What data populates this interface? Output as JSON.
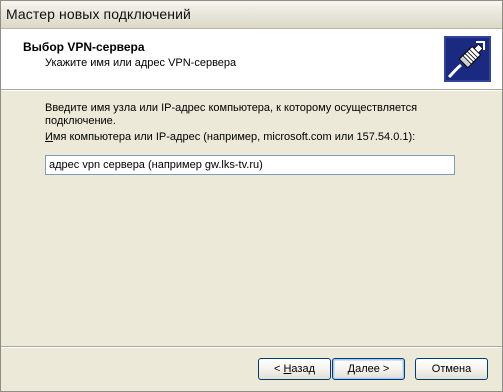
{
  "window": {
    "title": "Мастер новых подключений"
  },
  "header": {
    "title": "Выбор VPN-сервера",
    "subtitle": "Укажите имя или адрес VPN-сервера",
    "icon": "network-cable-icon"
  },
  "body": {
    "instruction": "Введите имя узла или IP-адрес компьютера, к которому осуществляется подключение.",
    "field_label_accel": "И",
    "field_label_rest": "мя компьютера или IP-адрес (например, microsoft.com или 157.54.0.1):",
    "host_value": "адрес vpn сервера (например gw.lks-tv.ru)"
  },
  "buttons": {
    "back_prefix": "< ",
    "back_accel": "Н",
    "back_rest": "азад",
    "next_accel": "Д",
    "next_rest": "алее >",
    "cancel": "Отмена"
  },
  "colors": {
    "dialog_bg": "#ece9d8",
    "header_bg": "#ffffff",
    "input_border": "#7f9db9",
    "button_border": "#003c74",
    "icon_bg": "#1a2a80"
  }
}
